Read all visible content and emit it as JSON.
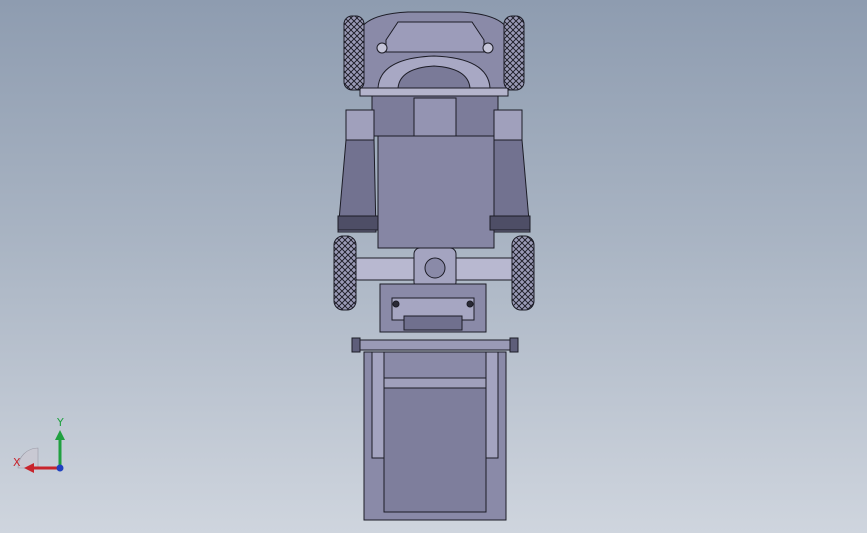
{
  "view": {
    "background_top": "#8e9cb0",
    "background_bottom": "#cfd5de",
    "model_fill": "#8a8aa8",
    "model_fill_light": "#b4b4cc",
    "model_fill_dark": "#5e5e7a",
    "edge_color": "#1c1c26"
  },
  "triad": {
    "x_label": "X",
    "y_label": "Y",
    "x_color": "#c8242c",
    "y_color": "#20a040",
    "z_color": "#2040c0",
    "x_icon": "x-axis-arrow-icon",
    "y_icon": "y-axis-arrow-icon",
    "z_icon": "z-axis-dot-icon"
  }
}
